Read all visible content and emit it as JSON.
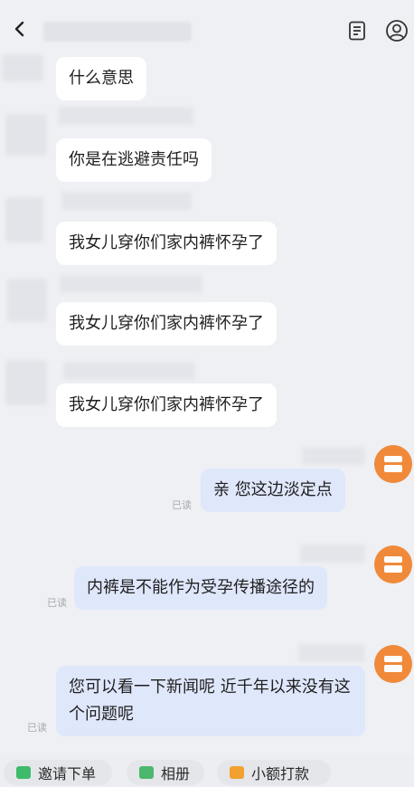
{
  "messages": [
    {
      "text": "什么意思"
    },
    {
      "text": "你是在逃避责任吗"
    },
    {
      "text": "我女儿穿你们家内裤怀孕了"
    },
    {
      "text": "我女儿穿你们家内裤怀孕了"
    },
    {
      "text": "我女儿穿你们家内裤怀孕了"
    },
    {
      "text": "亲 您这边淡定点",
      "status": "已读"
    },
    {
      "text": "内裤是不能作为受孕传播途径的",
      "status": "已读"
    },
    {
      "text": "您可以看一下新闻呢 近千年以来没有这个问题呢",
      "status": "已读"
    }
  ],
  "bottom_actions": [
    {
      "label": "邀请下单",
      "icon": "green-order-icon"
    },
    {
      "label": "相册",
      "icon": "album-icon"
    },
    {
      "label": "小额打款",
      "icon": "payment-icon"
    }
  ],
  "colors": {
    "background": "#eff0f4",
    "outgoing_bubble": "#dfe7fb",
    "incoming_bubble": "#ffffff",
    "shop_avatar": "#f08a3a"
  }
}
